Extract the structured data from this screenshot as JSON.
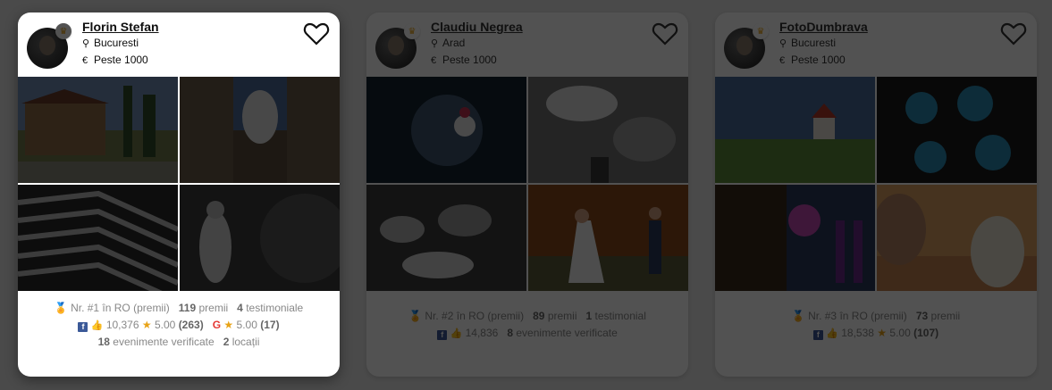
{
  "cards": [
    {
      "name": "Florin Stefan",
      "location": "Bucuresti",
      "price": "Peste 1000",
      "rank": "Nr. #1",
      "rank_suffix": "în RO (premii)",
      "awards": "119",
      "awards_label": "premii",
      "testimonials": "4",
      "testimonials_label": "testimoniale",
      "fb_likes": "10,376",
      "fb_rating": "5.00",
      "fb_reviews": "(263)",
      "g_rating": "5.00",
      "g_reviews": "(17)",
      "events": "18",
      "events_label": "evenimente verificate",
      "locations": "2",
      "locations_label": "locații"
    },
    {
      "name": "Claudiu Negrea",
      "location": "Arad",
      "price": "Peste 1000",
      "rank": "Nr. #2",
      "rank_suffix": "în RO (premii)",
      "awards": "89",
      "awards_label": "premii",
      "testimonials": "1",
      "testimonials_label": "testimonial",
      "fb_likes": "14,836",
      "events": "8",
      "events_label": "evenimente verificate"
    },
    {
      "name": "FotoDumbrava",
      "location": "Bucuresti",
      "price": "Peste 1000",
      "rank": "Nr. #3",
      "rank_suffix": "în RO (premii)",
      "awards": "73",
      "awards_label": "premii",
      "fb_likes": "18,538",
      "fb_rating": "5.00",
      "fb_reviews": "(107)"
    }
  ],
  "icons": {
    "location": "map-pin-icon",
    "price": "euro-icon",
    "favorite": "heart-icon",
    "premium": "crown-icon",
    "rank": "medal-icon"
  },
  "colors": {
    "accent": "#e8a317",
    "facebook": "#3b5998",
    "google": "#e53935"
  }
}
